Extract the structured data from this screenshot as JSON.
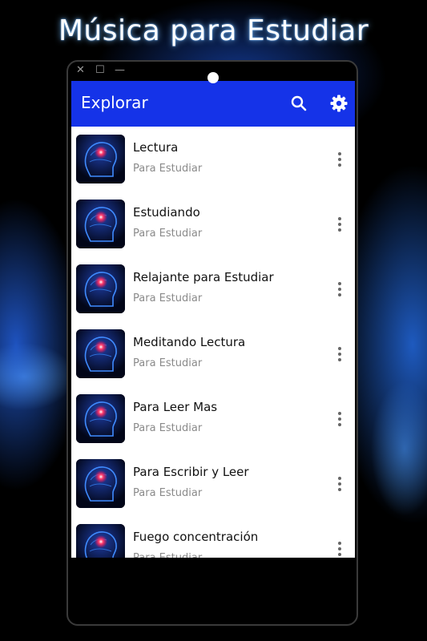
{
  "page_title": "Música para Estudiar",
  "window_controls": {
    "close": "✕",
    "restore": "☐",
    "minimize": "—"
  },
  "appbar": {
    "title": "Explorar",
    "search_icon": "search-icon",
    "settings_icon": "gear-icon"
  },
  "colors": {
    "appbar": "#1533e8",
    "accent_glow": "#3a7bff"
  },
  "tracks": [
    {
      "title": "Lectura",
      "subtitle": "Para Estudiar"
    },
    {
      "title": "Estudiando",
      "subtitle": "Para Estudiar"
    },
    {
      "title": "Relajante para Estudiar",
      "subtitle": "Para Estudiar"
    },
    {
      "title": "Meditando Lectura",
      "subtitle": "Para Estudiar"
    },
    {
      "title": "Para Leer Mas",
      "subtitle": "Para Estudiar"
    },
    {
      "title": "Para Escribir y Leer",
      "subtitle": "Para Estudiar"
    },
    {
      "title": "Fuego concentración",
      "subtitle": "Para Estudiar"
    }
  ]
}
